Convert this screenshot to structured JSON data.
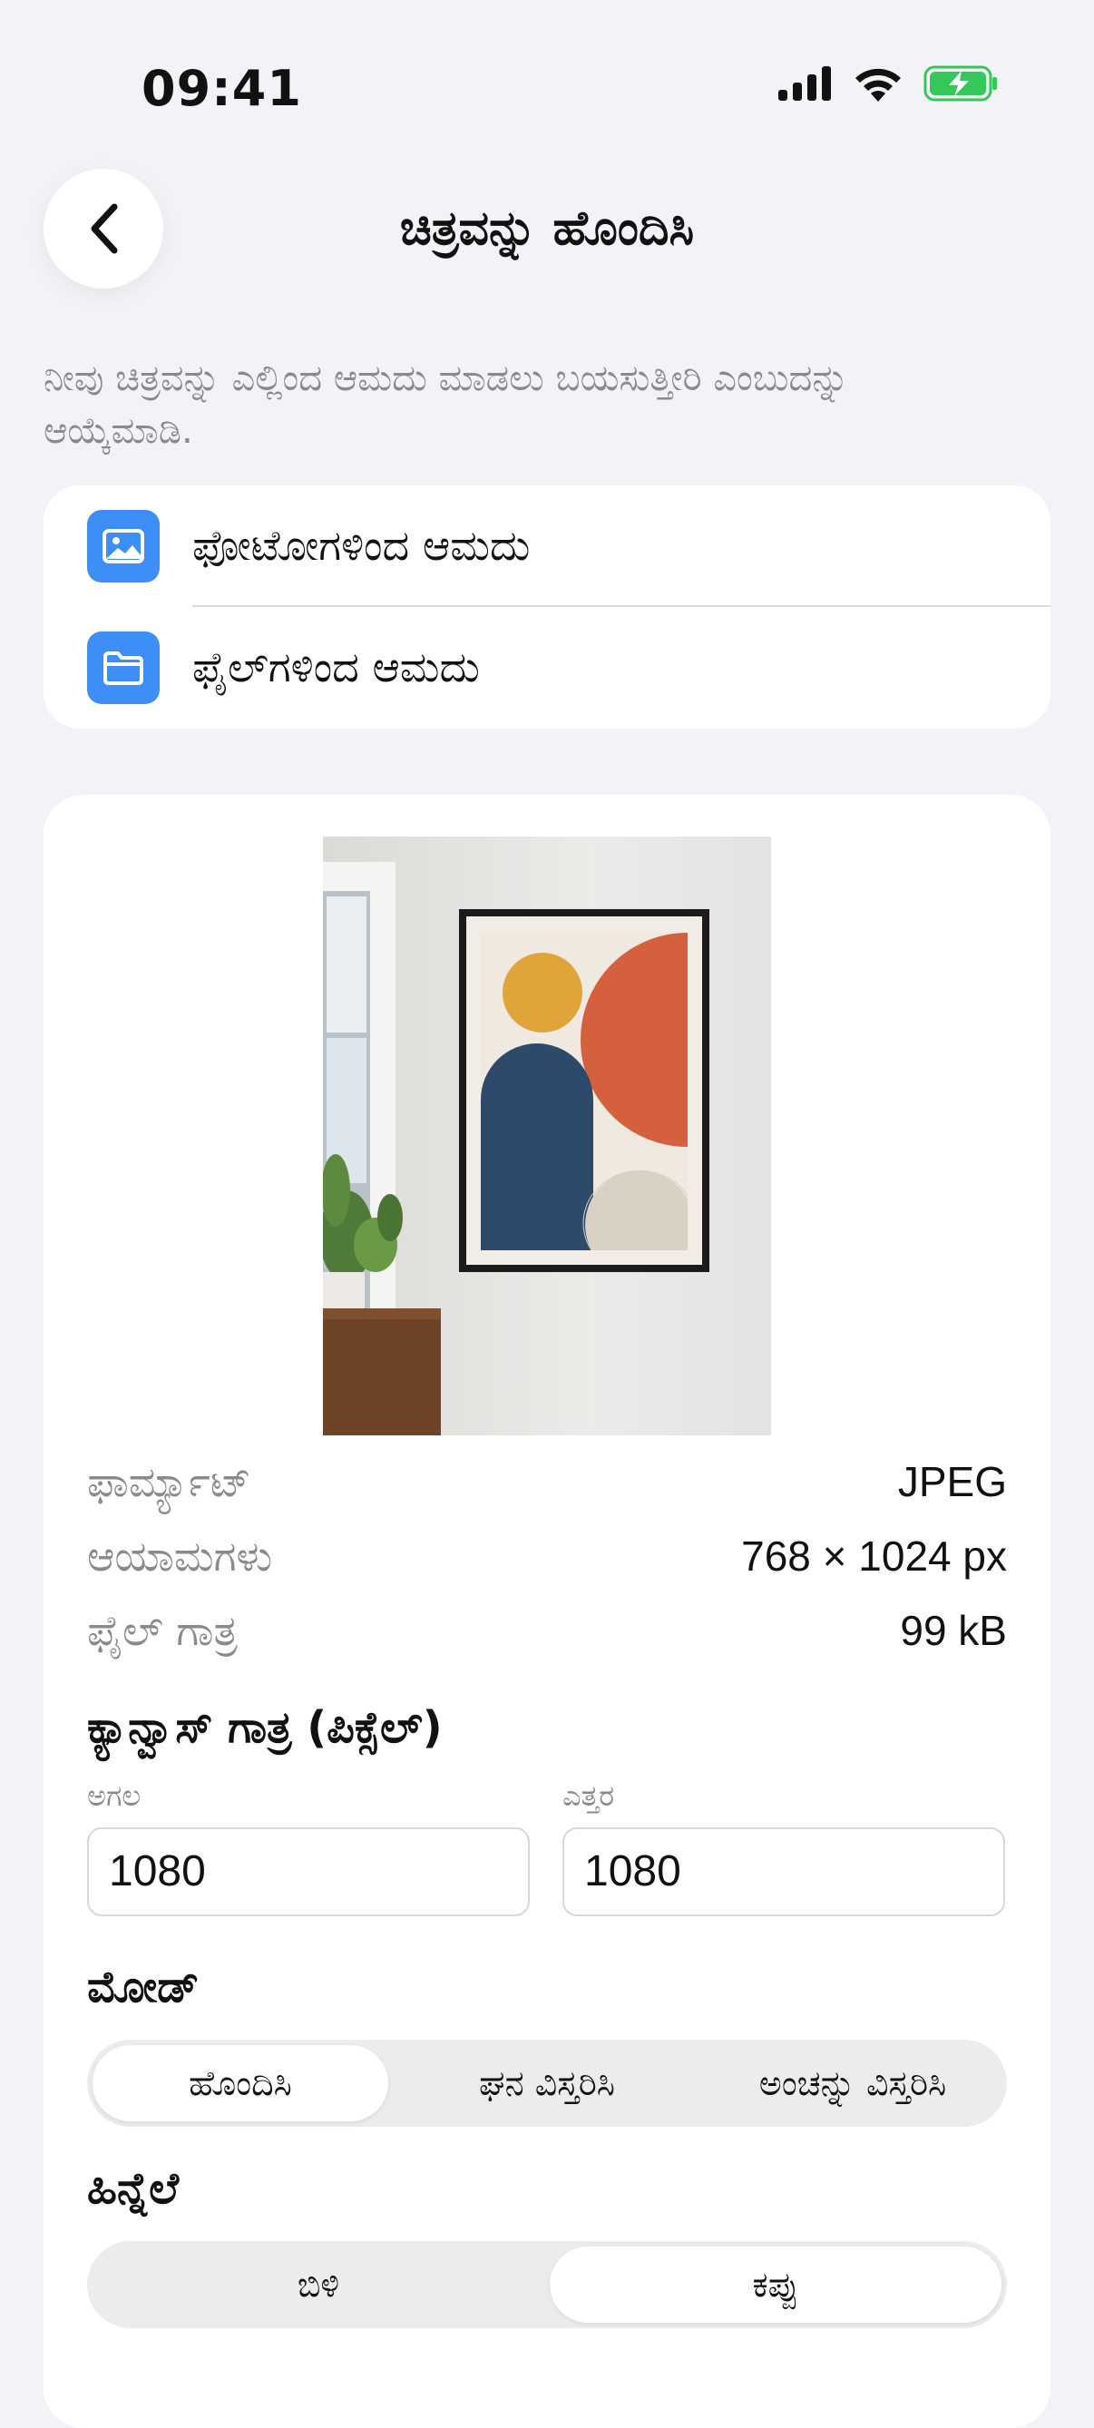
{
  "status_bar": {
    "time": "09:41"
  },
  "header": {
    "title": "ಚಿತ್ರವನ್ನು ಹೊಂದಿಸಿ"
  },
  "intro_text": "ನೀವು ಚಿತ್ರವನ್ನು ಎಲ್ಲಿಂದ ಆಮದು ಮಾಡಲು ಬಯಸುತ್ತೀರಿ ಎಂಬುದನ್ನು ಆಯ್ಕೆಮಾಡಿ.",
  "sources": [
    {
      "label": "ಫೋಟೋಗಳಿಂದ ಆಮದು",
      "icon": "photo-icon"
    },
    {
      "label": "ಫೈಲ್‌ಗಳಿಂದ ಆಮದು",
      "icon": "folder-icon"
    }
  ],
  "file_info": {
    "format_label": "ಫಾರ್ಮ್ಯಾಟ್",
    "format_value": "JPEG",
    "dimensions_label": "ಆಯಾಮಗಳು",
    "dimensions_value": "768 × 1024 px",
    "size_label": "ಫೈಲ್ ಗಾತ್ರ",
    "size_value": "99 kB"
  },
  "canvas": {
    "title": "ಕ್ಯಾನ್ವಾಸ್ ಗಾತ್ರ (ಪಿಕ್ಸೆಲ್)",
    "width_label": "ಅಗಲ",
    "width_value": "1080",
    "height_label": "ಎತ್ತರ",
    "height_value": "1080"
  },
  "mode": {
    "title": "ಮೋಡ್",
    "options": [
      "ಹೊಂದಿಸಿ",
      "ಘನ ವಿಸ್ತರಿಸಿ",
      "ಅಂಚನ್ನು ವಿಸ್ತರಿಸಿ"
    ],
    "selected": "ಹೊಂದಿಸಿ"
  },
  "background": {
    "title": "ಹಿನ್ನೆಲೆ",
    "options": [
      "ಬಿಳಿ",
      "ಕಪ್ಪು"
    ],
    "selected": "ಕಪ್ಪು"
  },
  "colors": {
    "accent": "#3d8ff5",
    "battery": "#34c759",
    "page_bg": "#f2f2f7"
  }
}
